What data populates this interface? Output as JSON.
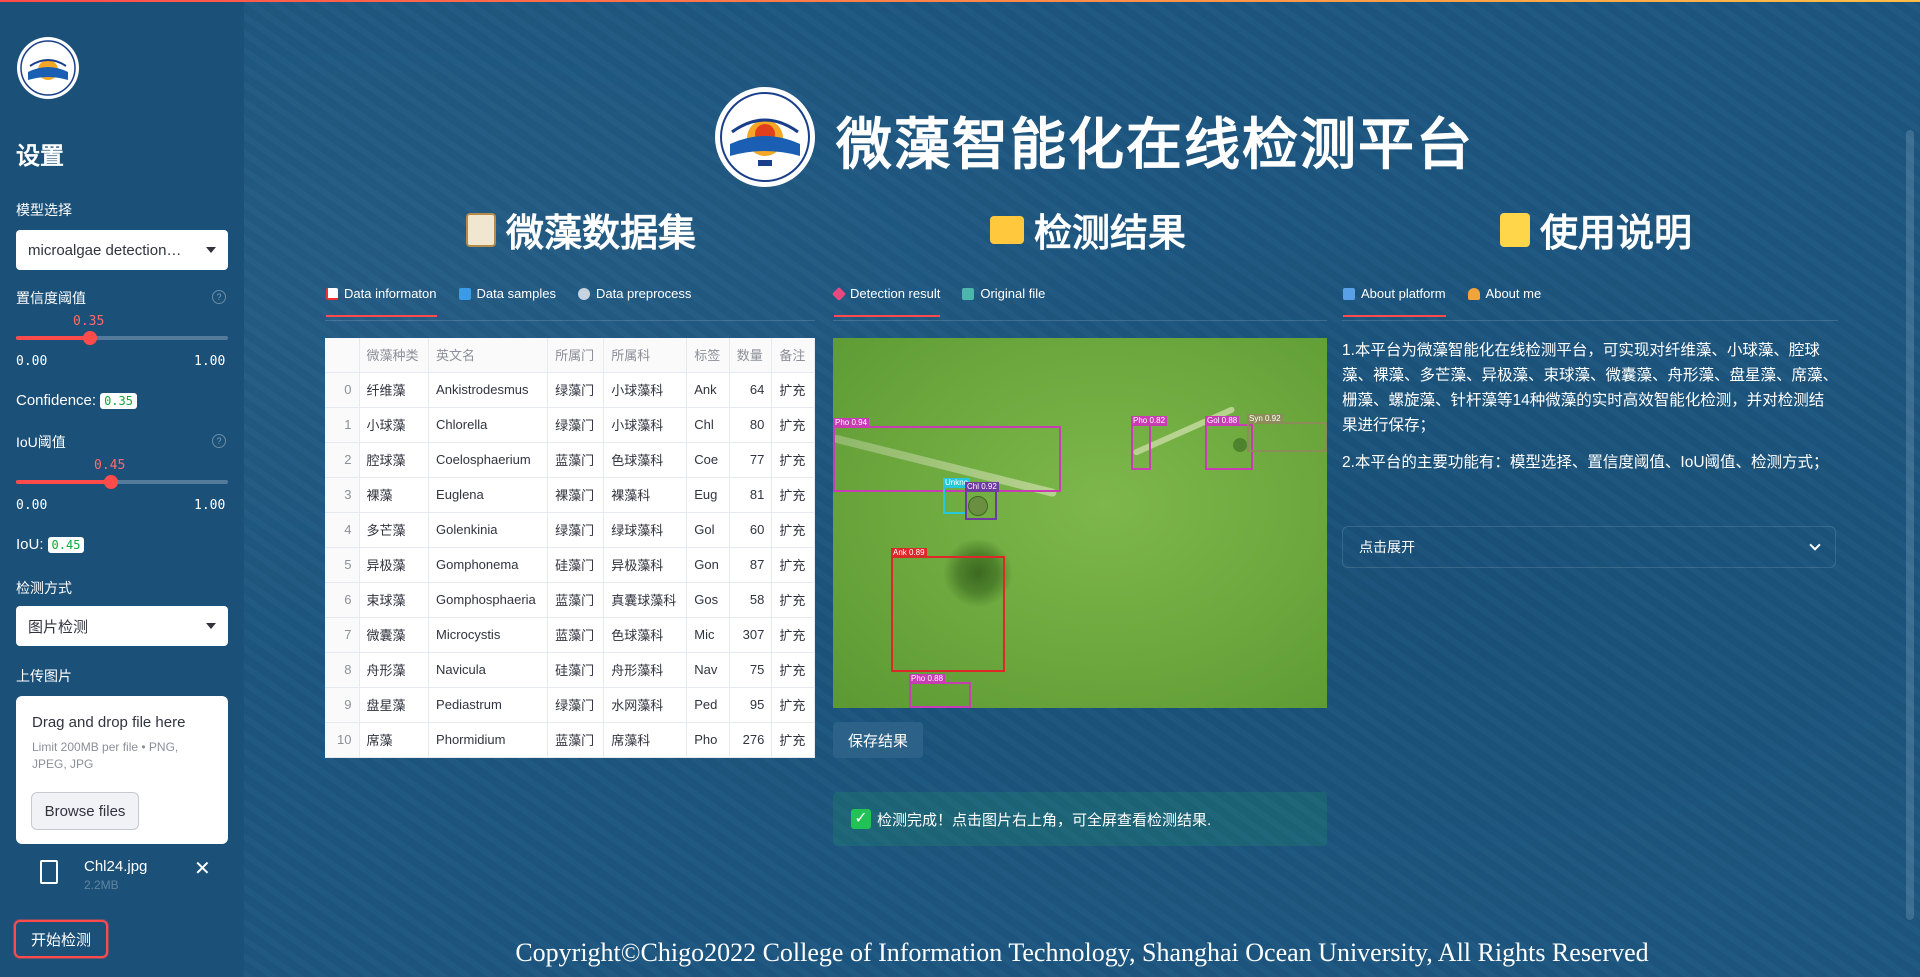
{
  "sidebar": {
    "title": "设置",
    "model_label": "模型选择",
    "model_value": "microalgae detection…",
    "conf_label": "置信度阈值",
    "conf_value": "0.35",
    "conf_fraction": 0.35,
    "iou_label": "IoU阈值",
    "iou_value": "0.45",
    "iou_fraction": 0.45,
    "range_min": "0.00",
    "range_max": "1.00",
    "confidence_text": "Confidence:",
    "iou_text": "IoU:",
    "method_label": "检测方式",
    "method_value": "图片检测",
    "upload_label": "上传图片",
    "upload_drag": "Drag and drop file here",
    "upload_limit": "Limit 200MB per file • PNG, JPEG, JPG",
    "browse_label": "Browse files",
    "file_name": "Chl24.jpg",
    "file_size": "2.2MB",
    "start_label": "开始检测"
  },
  "header": {
    "title": "微藻智能化在线检测平台"
  },
  "sections": {
    "dataset": "微藻数据集",
    "result": "检测结果",
    "usage": "使用说明"
  },
  "tabs_dataset": [
    "Data informaton",
    "Data samples",
    "Data preprocess"
  ],
  "tabs_result": [
    "Detection result",
    "Original file"
  ],
  "tabs_usage": [
    "About platform",
    "About me"
  ],
  "table": {
    "columns": [
      "",
      "微藻种类",
      "英文名",
      "所属门",
      "所属科",
      "标签",
      "数量",
      "备注"
    ],
    "rows": [
      [
        "0",
        "纤维藻",
        "Ankistrodesmus",
        "绿藻门",
        "小球藻科",
        "Ank",
        "64",
        "扩充"
      ],
      [
        "1",
        "小球藻",
        "Chlorella",
        "绿藻门",
        "小球藻科",
        "Chl",
        "80",
        "扩充"
      ],
      [
        "2",
        "腔球藻",
        "Coelosphaerium",
        "蓝藻门",
        "色球藻科",
        "Coe",
        "77",
        "扩充"
      ],
      [
        "3",
        "裸藻",
        "Euglena",
        "裸藻门",
        "裸藻科",
        "Eug",
        "81",
        "扩充"
      ],
      [
        "4",
        "多芒藻",
        "Golenkinia",
        "绿藻门",
        "绿球藻科",
        "Gol",
        "60",
        "扩充"
      ],
      [
        "5",
        "异极藻",
        "Gomphonema",
        "硅藻门",
        "异极藻科",
        "Gon",
        "87",
        "扩充"
      ],
      [
        "6",
        "束球藻",
        "Gomphosphaeria",
        "蓝藻门",
        "真囊球藻科",
        "Gos",
        "58",
        "扩充"
      ],
      [
        "7",
        "微囊藻",
        "Microcystis",
        "蓝藻门",
        "色球藻科",
        "Mic",
        "307",
        "扩充"
      ],
      [
        "8",
        "舟形藻",
        "Navicula",
        "硅藻门",
        "舟形藻科",
        "Nav",
        "75",
        "扩充"
      ],
      [
        "9",
        "盘星藻",
        "Pediastrum",
        "绿藻门",
        "水网藻科",
        "Ped",
        "95",
        "扩充"
      ],
      [
        "10",
        "席藻",
        "Phormidium",
        "蓝藻门",
        "席藻科",
        "Pho",
        "276",
        "扩充"
      ]
    ]
  },
  "detections": [
    {
      "label": "Pho 0.94",
      "color": "#c83cb4"
    },
    {
      "label": "Pho 0.82",
      "color": "#c83cb4"
    },
    {
      "label": "Gol 0.88",
      "color": "#c83cb4"
    },
    {
      "label": "Syn 0.92",
      "color": "#8c8c5a"
    },
    {
      "label": "Unkno",
      "color": "#28c8dc"
    },
    {
      "label": "Chl 0.92",
      "color": "#6e3ca0"
    },
    {
      "label": "Ank 0.89",
      "color": "#dc2828"
    },
    {
      "label": "Pho 0.88",
      "color": "#c83cb4"
    }
  ],
  "save_label": "保存结果",
  "success_text": "检测完成！点击图片右上角，可全屏查看检测结果.",
  "about": {
    "p1": "1.本平台为微藻智能化在线检测平台，可实现对纤维藻、小球藻、腔球藻、裸藻、多芒藻、异极藻、束球藻、微囊藻、舟形藻、盘星藻、席藻、栅藻、螺旋藻、针杆藻等14种微藻的实时高效智能化检测，并对检测结果进行保存；",
    "p2": "2.本平台的主要功能有：模型选择、置信度阈值、IoU阈值、检测方式；",
    "expander": "点击展开"
  },
  "footer": "Copyright©Chigo2022 College of Information Technology, Shanghai Ocean University, All Rights Reserved",
  "colors": {
    "background": "#1c5680",
    "accent": "#ff4b4b",
    "success": "#21c354"
  }
}
